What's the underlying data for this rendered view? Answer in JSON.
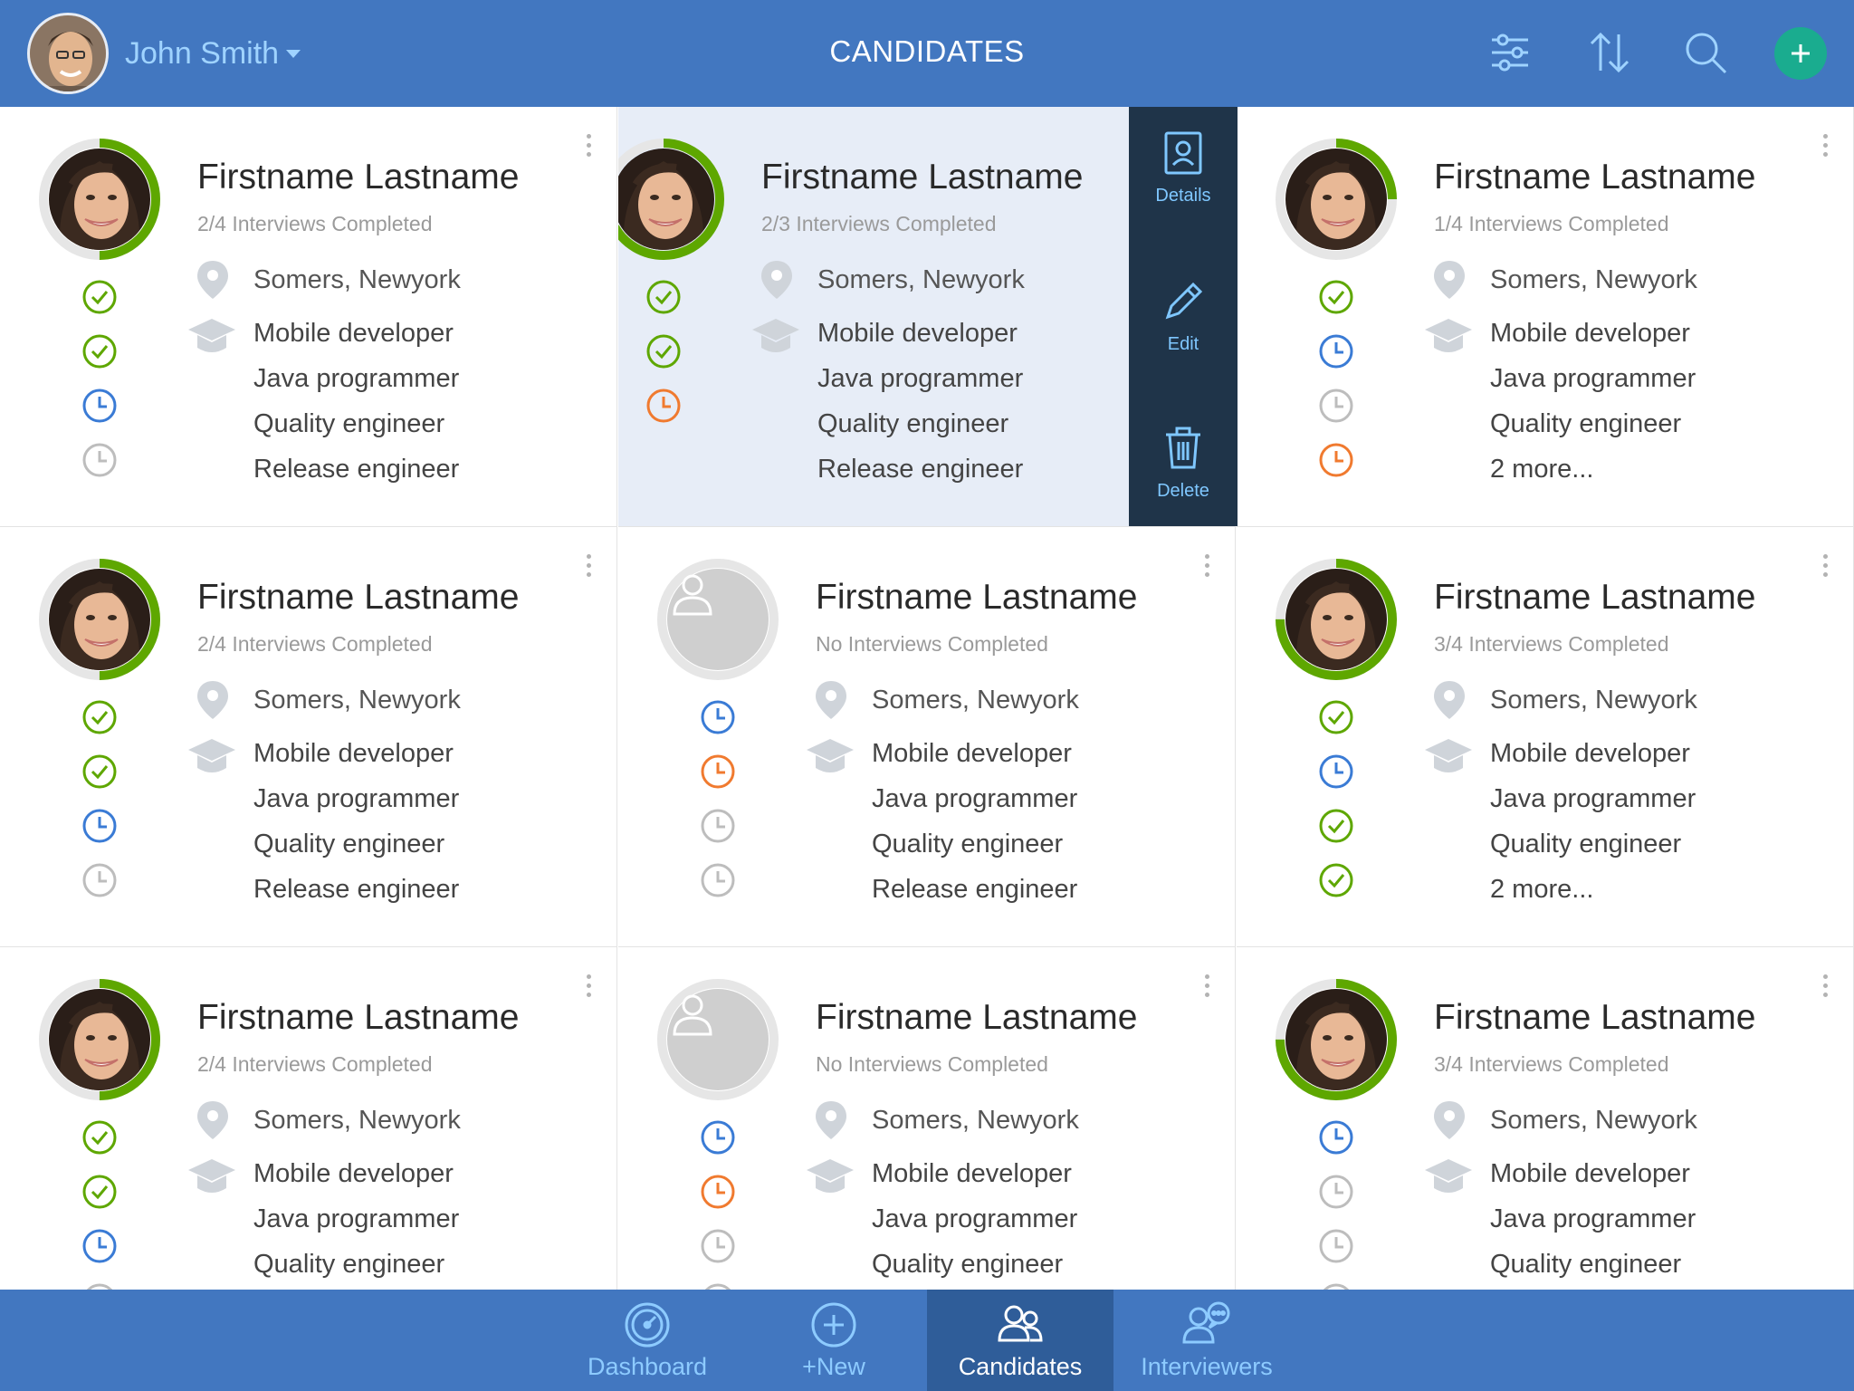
{
  "header": {
    "user_name": "John Smith",
    "title": "CANDIDATES",
    "icons": [
      "filter-icon",
      "sort-icon",
      "search-icon",
      "add-icon"
    ]
  },
  "colors": {
    "primary": "#4277c0",
    "accent_green": "#1aac8f",
    "progress_green": "#5ea700",
    "status_blue": "#3a7bd5",
    "status_orange": "#f07a2f",
    "status_gray": "#bdbdbd",
    "panel_dark": "#1f3449"
  },
  "card_actions": {
    "details_label": "Details",
    "edit_label": "Edit",
    "delete_label": "Delete"
  },
  "cards": [
    {
      "name": "Firstname Lastname",
      "progress_text": "2/4 Interviews Completed",
      "progress": 0.5,
      "photo": true,
      "location": "Somers, Newyork",
      "skills": [
        "Mobile developer",
        "Java programmer",
        "Quality engineer",
        "Release engineer"
      ],
      "statuses": [
        "done",
        "done",
        "scheduled",
        "pending"
      ]
    },
    {
      "name": "Firstname Lastname",
      "progress_text": "2/3 Interviews Completed",
      "progress": 0.667,
      "photo": true,
      "location": "Somers, Newyork",
      "skills": [
        "Mobile developer",
        "Java programmer",
        "Quality engineer",
        "Release engineer"
      ],
      "statuses": [
        "done",
        "done",
        "overdue"
      ]
    },
    {
      "name": "Firstname Lastname",
      "progress_text": "1/4 Interviews Completed",
      "progress": 0.25,
      "photo": true,
      "location": "Somers, Newyork",
      "skills": [
        "Mobile developer",
        "Java programmer",
        "Quality engineer",
        "2 more..."
      ],
      "statuses": [
        "done",
        "scheduled",
        "pending",
        "overdue"
      ]
    },
    {
      "name": "Firstname Lastname",
      "progress_text": "2/4 Interviews Completed",
      "progress": 0.5,
      "photo": true,
      "location": "Somers, Newyork",
      "skills": [
        "Mobile developer",
        "Java programmer",
        "Quality engineer",
        "Release engineer"
      ],
      "statuses": [
        "done",
        "done",
        "scheduled",
        "pending"
      ]
    },
    {
      "name": "Firstname Lastname",
      "progress_text": "No Interviews Completed",
      "progress": 0,
      "photo": false,
      "location": "Somers, Newyork",
      "skills": [
        "Mobile developer",
        "Java programmer",
        "Quality engineer",
        "Release engineer"
      ],
      "statuses": [
        "scheduled",
        "overdue",
        "pending",
        "pending"
      ]
    },
    {
      "name": "Firstname Lastname",
      "progress_text": "3/4 Interviews Completed",
      "progress": 0.75,
      "photo": true,
      "location": "Somers, Newyork",
      "skills": [
        "Mobile developer",
        "Java programmer",
        "Quality engineer",
        "2 more..."
      ],
      "statuses": [
        "done",
        "scheduled",
        "done",
        "done"
      ]
    },
    {
      "name": "Firstname Lastname",
      "progress_text": "2/4 Interviews Completed",
      "progress": 0.5,
      "photo": true,
      "location": "Somers, Newyork",
      "skills": [
        "Mobile developer",
        "Java programmer",
        "Quality engineer"
      ],
      "statuses": [
        "done",
        "done",
        "scheduled",
        "pending"
      ]
    },
    {
      "name": "Firstname Lastname",
      "progress_text": "No Interviews Completed",
      "progress": 0,
      "photo": false,
      "location": "Somers, Newyork",
      "skills": [
        "Mobile developer",
        "Java programmer",
        "Quality engineer"
      ],
      "statuses": [
        "scheduled",
        "overdue",
        "pending",
        "pending"
      ]
    },
    {
      "name": "Firstname Lastname",
      "progress_text": "3/4 Interviews Completed",
      "progress": 0.75,
      "photo": true,
      "location": "Somers, Newyork",
      "skills": [
        "Mobile developer",
        "Java programmer",
        "Quality engineer"
      ],
      "statuses": [
        "scheduled",
        "pending",
        "pending",
        "pending"
      ]
    }
  ],
  "tabs": [
    {
      "label": "Dashboard",
      "icon": "dashboard-icon",
      "active": false
    },
    {
      "label": "+New",
      "icon": "add-circle-icon",
      "active": false
    },
    {
      "label": "Candidates",
      "icon": "candidates-icon",
      "active": true
    },
    {
      "label": "Interviewers",
      "icon": "interviewers-icon",
      "active": false
    }
  ]
}
